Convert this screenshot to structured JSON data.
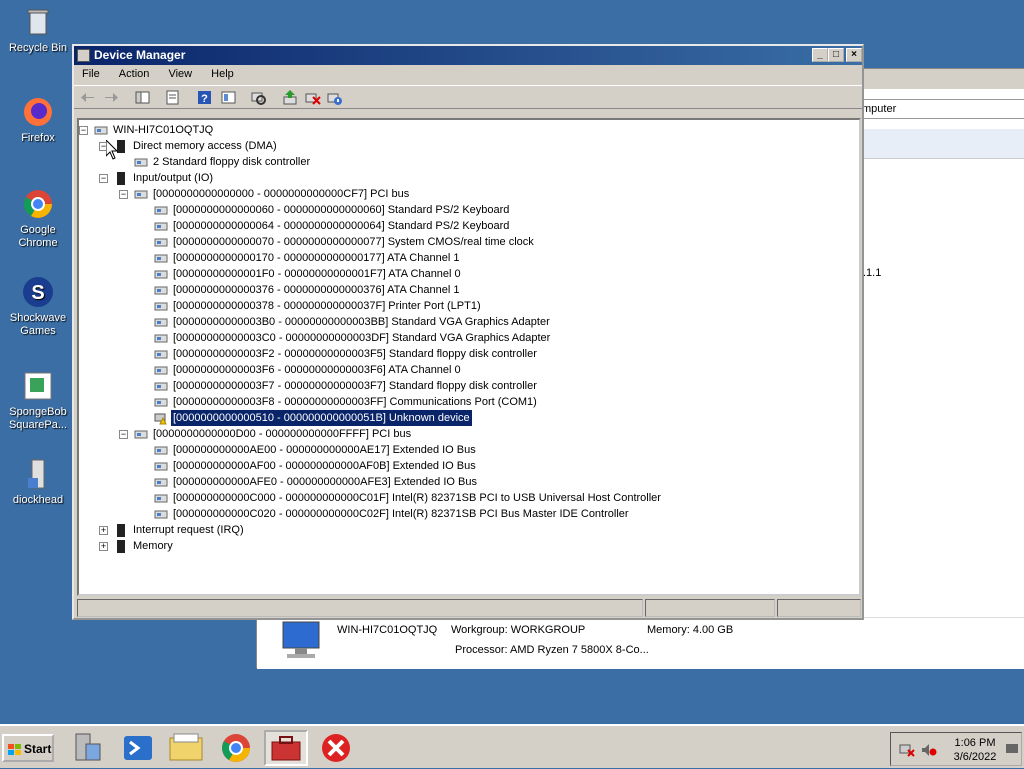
{
  "desktop": {
    "icons": [
      {
        "label": "Recycle Bin",
        "icon": "recycle-bin-icon"
      },
      {
        "label": "Firefox",
        "icon": "firefox-icon"
      },
      {
        "label": "Google Chrome",
        "icon": "chrome-icon"
      },
      {
        "label": "Shockwave Games",
        "icon": "shockwave-icon"
      },
      {
        "label": "SpongeBob SquarePa...",
        "icon": "spongebob-icon"
      },
      {
        "label": "diockhead",
        "icon": "diockhead-icon"
      }
    ]
  },
  "bg_window": {
    "address_text": "mputer",
    "number_text": ".1.1",
    "computer_name": "WIN-HI7C01OQTJQ",
    "workgroup": "Workgroup: WORKGROUP",
    "memory": "Memory: 4.00 GB",
    "processor": "Processor: AMD Ryzen 7 5800X 8-Co..."
  },
  "window": {
    "title": "Device Manager",
    "menu": [
      "File",
      "Action",
      "View",
      "Help"
    ],
    "tree": [
      {
        "text": "WIN-HI7C01OQTJQ",
        "level": 0,
        "expander": "-"
      },
      {
        "text": "Direct memory access (DMA)",
        "level": 1,
        "expander": "-"
      },
      {
        "text": "2    Standard floppy disk controller",
        "level": 2,
        "expander": ""
      },
      {
        "text": "Input/output (IO)",
        "level": 1,
        "expander": "-"
      },
      {
        "text": "[0000000000000000 - 0000000000000CF7]  PCI bus",
        "level": 2,
        "expander": "-"
      },
      {
        "text": "[0000000000000060 - 0000000000000060]  Standard PS/2 Keyboard",
        "level": 3,
        "expander": ""
      },
      {
        "text": "[0000000000000064 - 0000000000000064]  Standard PS/2 Keyboard",
        "level": 3,
        "expander": ""
      },
      {
        "text": "[0000000000000070 - 0000000000000077]  System CMOS/real time clock",
        "level": 3,
        "expander": ""
      },
      {
        "text": "[0000000000000170 - 0000000000000177]  ATA Channel 1",
        "level": 3,
        "expander": ""
      },
      {
        "text": "[00000000000001F0 - 00000000000001F7]  ATA Channel 0",
        "level": 3,
        "expander": ""
      },
      {
        "text": "[0000000000000376 - 0000000000000376]  ATA Channel 1",
        "level": 3,
        "expander": ""
      },
      {
        "text": "[0000000000000378 - 000000000000037F]  Printer Port (LPT1)",
        "level": 3,
        "expander": ""
      },
      {
        "text": "[00000000000003B0 - 00000000000003BB]  Standard VGA Graphics Adapter",
        "level": 3,
        "expander": ""
      },
      {
        "text": "[00000000000003C0 - 00000000000003DF]  Standard VGA Graphics Adapter",
        "level": 3,
        "expander": ""
      },
      {
        "text": "[00000000000003F2 - 00000000000003F5]  Standard floppy disk controller",
        "level": 3,
        "expander": ""
      },
      {
        "text": "[00000000000003F6 - 00000000000003F6]  ATA Channel 0",
        "level": 3,
        "expander": ""
      },
      {
        "text": "[00000000000003F7 - 00000000000003F7]  Standard floppy disk controller",
        "level": 3,
        "expander": ""
      },
      {
        "text": "[00000000000003F8 - 00000000000003FF]  Communications Port (COM1)",
        "level": 3,
        "expander": ""
      },
      {
        "text": "[0000000000000510 - 000000000000051B]  Unknown device",
        "level": 3,
        "expander": "",
        "selected": true
      },
      {
        "text": "[0000000000000D00 - 000000000000FFFF]  PCI bus",
        "level": 2,
        "expander": "-"
      },
      {
        "text": "[000000000000AE00 - 000000000000AE17]  Extended IO Bus",
        "level": 3,
        "expander": ""
      },
      {
        "text": "[000000000000AF00 - 000000000000AF0B]  Extended IO Bus",
        "level": 3,
        "expander": ""
      },
      {
        "text": "[000000000000AFE0 - 000000000000AFE3]  Extended IO Bus",
        "level": 3,
        "expander": ""
      },
      {
        "text": "[000000000000C000 - 000000000000C01F]  Intel(R) 82371SB PCI to USB Universal Host Controller",
        "level": 3,
        "expander": ""
      },
      {
        "text": "[000000000000C020 - 000000000000C02F]  Intel(R) 82371SB PCI Bus Master IDE Controller",
        "level": 3,
        "expander": ""
      },
      {
        "text": "Interrupt request (IRQ)",
        "level": 1,
        "expander": "+"
      },
      {
        "text": "Memory",
        "level": 1,
        "expander": "+"
      }
    ]
  },
  "taskbar": {
    "start_label": "Start",
    "clock_time": "1:06 PM",
    "clock_date": "3/6/2022"
  },
  "colors": {
    "desktop": "#3a6ea5",
    "selection": "#0a246a",
    "title_gradient_start": "#0a246a"
  }
}
